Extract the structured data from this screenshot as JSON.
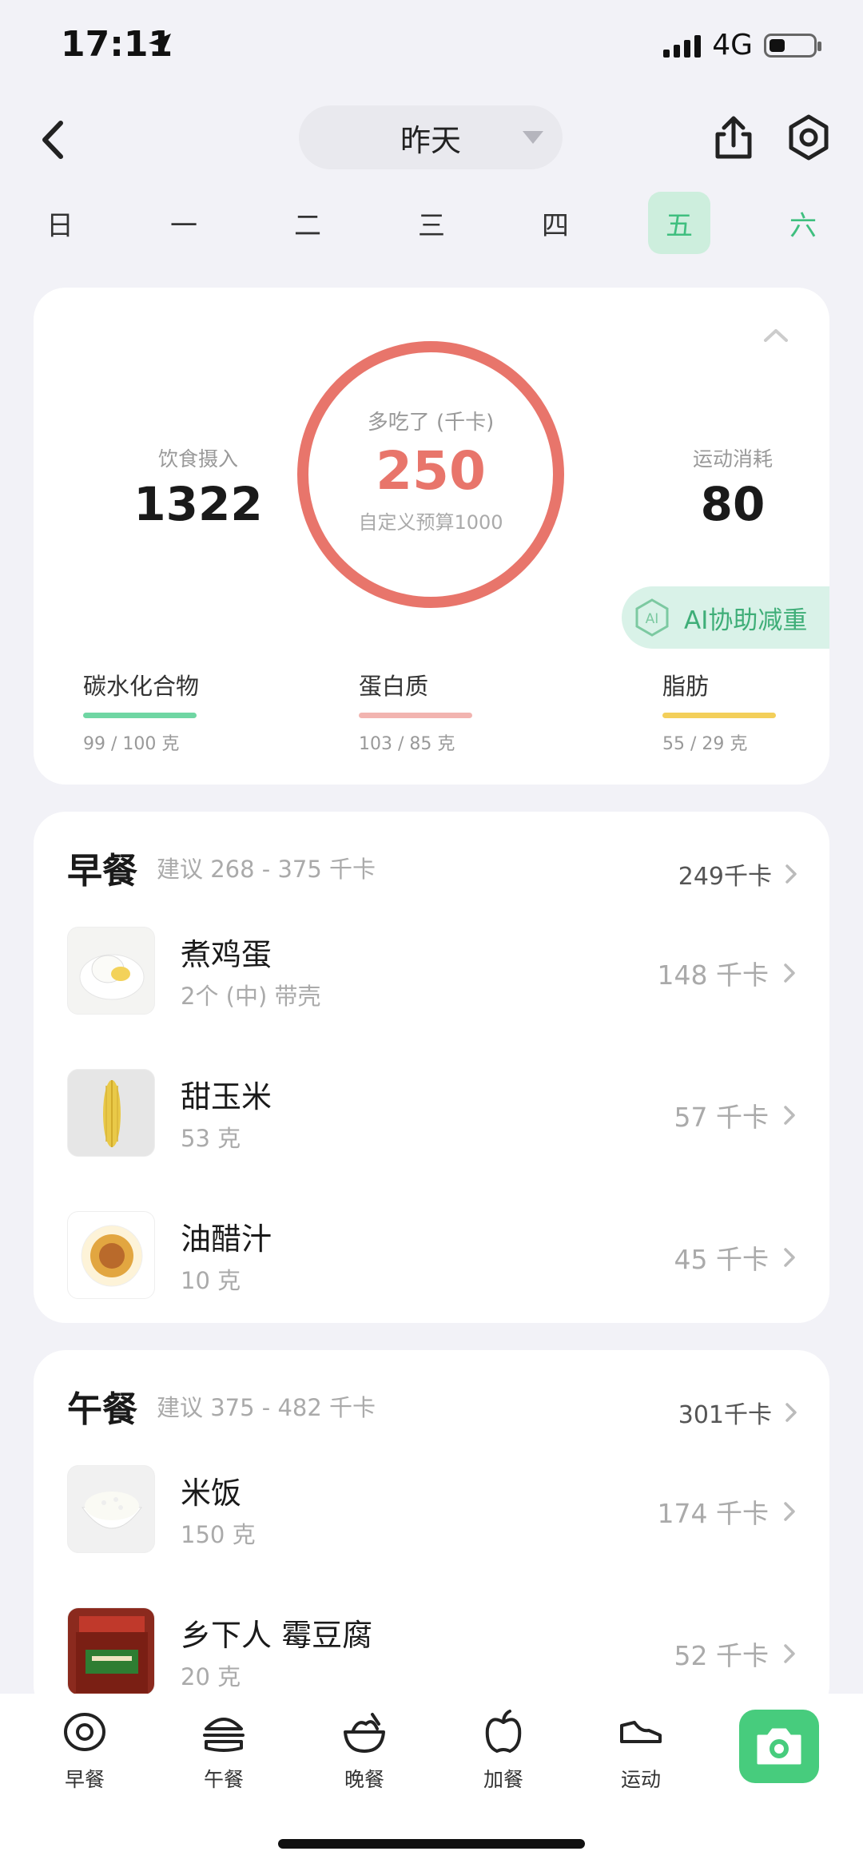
{
  "status": {
    "time": "17:11",
    "network": "4G",
    "battery_level": 0.35
  },
  "nav": {
    "date_label": "昨天"
  },
  "week": {
    "days": [
      "日",
      "一",
      "二",
      "三",
      "四",
      "五",
      "六"
    ],
    "active_index": 5
  },
  "summary": {
    "intake_label": "饮食摄入",
    "intake_value": "1322",
    "ring_label": "多吃了 (千卡)",
    "ring_value": "250",
    "ring_sub": "自定义预算1000",
    "exercise_label": "运动消耗",
    "exercise_value": "80",
    "ai_label": "AI协助减重",
    "ai_badge": "AI",
    "macros": [
      {
        "name": "碳水化合物",
        "amount": "99 / 100 克",
        "color": "#6fd6a3"
      },
      {
        "name": "蛋白质",
        "amount": "103 / 85 克",
        "color": "#f2b4b0"
      },
      {
        "name": "脂肪",
        "amount": "55 / 29 克",
        "color": "#f3cf5a"
      }
    ]
  },
  "breakfast": {
    "title": "早餐",
    "hint": "建议 268 - 375 千卡",
    "total": "249千卡",
    "items": [
      {
        "name": "煮鸡蛋",
        "qty": "2个 (中) 带壳",
        "kcal": "148 千卡"
      },
      {
        "name": "甜玉米",
        "qty": "53 克",
        "kcal": "57 千卡"
      },
      {
        "name": "油醋汁",
        "qty": "10 克",
        "kcal": "45 千卡"
      }
    ]
  },
  "lunch": {
    "title": "午餐",
    "hint": "建议 375 - 482 千卡",
    "total": "301千卡",
    "items": [
      {
        "name": "米饭",
        "qty": "150 克",
        "kcal": "174 千卡"
      },
      {
        "name": "乡下人 霉豆腐",
        "qty": "20 克",
        "kcal": "52 千卡"
      }
    ]
  },
  "tabbar": {
    "items": [
      "早餐",
      "午餐",
      "晚餐",
      "加餐",
      "运动"
    ]
  },
  "colors": {
    "accent_green": "#47cc7d",
    "ring_red": "#e8756b"
  }
}
